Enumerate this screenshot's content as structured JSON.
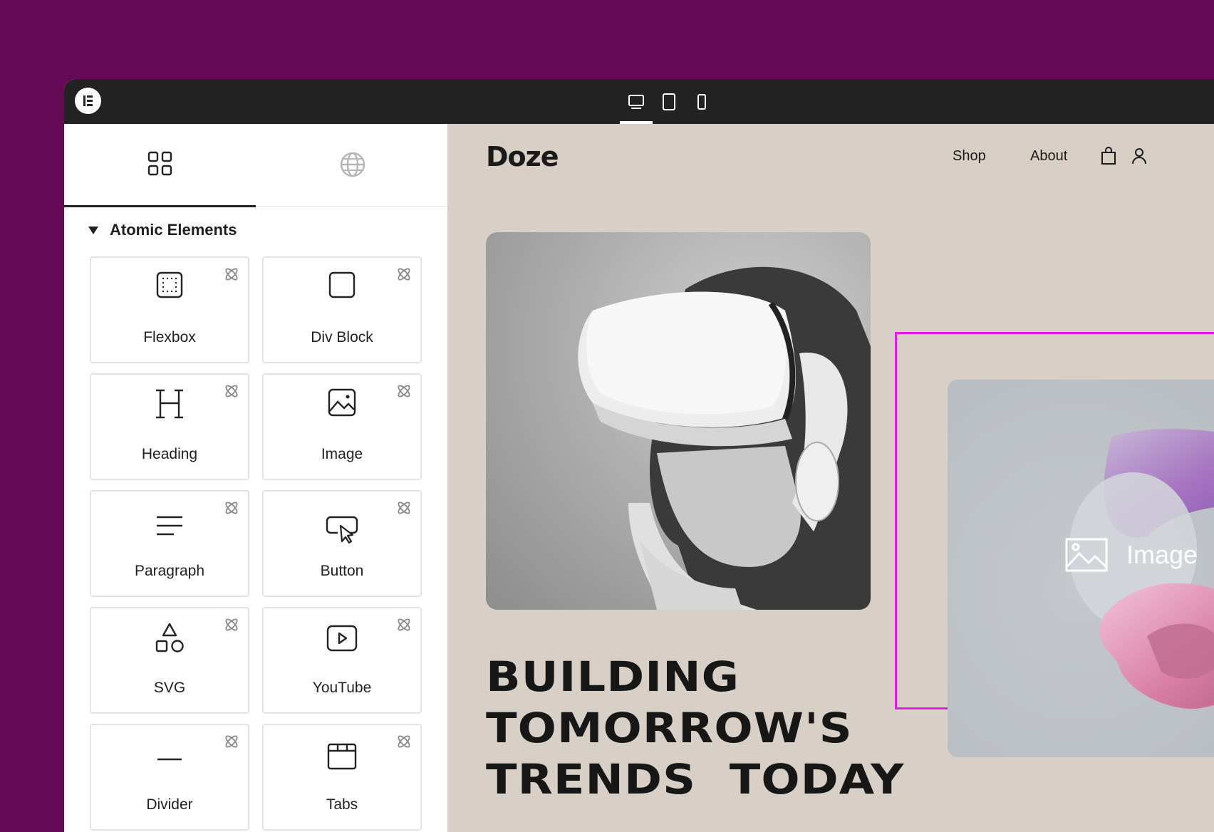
{
  "topbar": {
    "logo": "elementor-logo",
    "devices": [
      {
        "name": "desktop",
        "active": true
      },
      {
        "name": "tablet",
        "active": false
      },
      {
        "name": "mobile",
        "active": false
      }
    ]
  },
  "panel": {
    "tabs": [
      {
        "icon": "widgets-grid-icon",
        "active": true
      },
      {
        "icon": "globe-icon",
        "active": false
      }
    ],
    "section_title": "Atomic Elements",
    "elements": [
      {
        "label": "Flexbox",
        "icon": "flexbox-icon"
      },
      {
        "label": "Div Block",
        "icon": "div-block-icon"
      },
      {
        "label": "Heading",
        "icon": "heading-icon"
      },
      {
        "label": "Image",
        "icon": "image-icon"
      },
      {
        "label": "Paragraph",
        "icon": "paragraph-icon"
      },
      {
        "label": "Button",
        "icon": "button-icon"
      },
      {
        "label": "SVG",
        "icon": "svg-shapes-icon"
      },
      {
        "label": "YouTube",
        "icon": "youtube-icon"
      },
      {
        "label": "Divider",
        "icon": "divider-icon"
      },
      {
        "label": "Tabs",
        "icon": "tabs-icon"
      }
    ]
  },
  "site": {
    "brand": "Doze",
    "nav": {
      "shop": "Shop",
      "about": "About"
    },
    "headline": [
      "BUILDING",
      "TOMORROW'S",
      "TRENDS  TODAY"
    ],
    "placeholder_label": "Image"
  },
  "colors": {
    "background": "#660a57",
    "topbar": "#222222",
    "canvas": "#d8d0c6",
    "selection": "#e21ee0"
  }
}
